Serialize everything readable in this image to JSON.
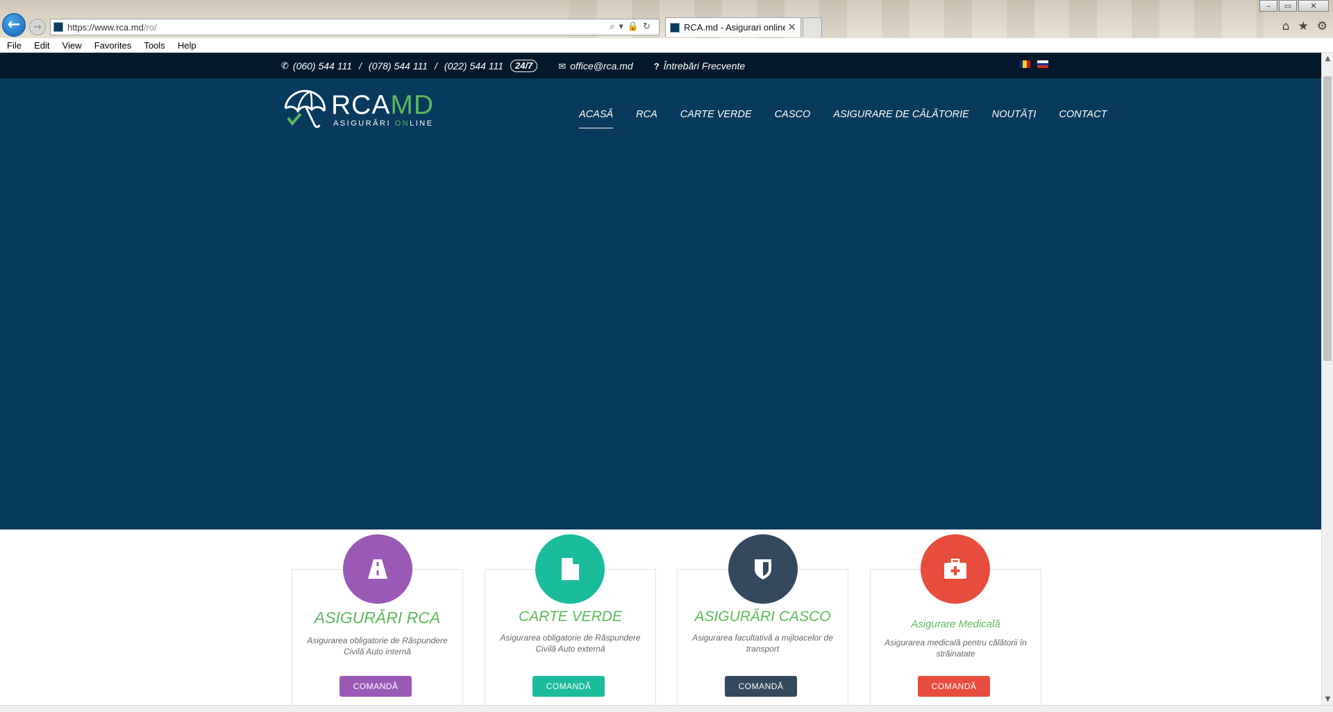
{
  "browser": {
    "url_host": "https://www.rca.md",
    "url_path": "/ro/",
    "tab_title": "RCA.md - Asigurari online -...",
    "tab_close": "✕",
    "menu": [
      "File",
      "Edit",
      "View",
      "Favorites",
      "Tools",
      "Help"
    ],
    "address_tools": "⌕▾🔒↻",
    "right_tools": [
      "⌂",
      "★",
      "⚙"
    ],
    "window_buttons": [
      "–",
      "▭",
      "✕"
    ]
  },
  "topbar": {
    "phones": [
      "(060) 544 111",
      "(078) 544 111",
      "(022) 544 111"
    ],
    "phone_separator": "/",
    "badge": "24/7",
    "email": "office@rca.md",
    "faq": "Întrebări Frecvente",
    "languages": [
      "ro",
      "ru"
    ],
    "flag_colors": {
      "ro": [
        "#002b7f",
        "#fcd116",
        "#ce1126"
      ],
      "ru": [
        "#ffffff",
        "#0039a6",
        "#d52b1e"
      ]
    }
  },
  "logo": {
    "text_primary": "RCA",
    "text_accent": "MD",
    "subtitle_pre": "ASIGURĂRI ",
    "subtitle_on": "ON",
    "subtitle_post": "LINE",
    "accent_color": "#5cb85c"
  },
  "nav": {
    "items": [
      "ACASĂ",
      "RCA",
      "CARTE VERDE",
      "CASCO",
      "ASIGURARE DE CĂLĂTORIE",
      "NOUTĂȚI",
      "CONTACT"
    ],
    "active_index": 0
  },
  "hero": {
    "background": "#083a5e"
  },
  "cards": [
    {
      "title": "ASIGURĂRI RCA",
      "desc": "Asigurarea obligatorie de Răspundere Civilă Auto internă",
      "button": "COMANDĂ",
      "color": "#9b59b6",
      "icon": "road-icon"
    },
    {
      "title": "CARTE VERDE",
      "desc": "Asigurarea obligatorie de Răspundere Civilă Auto externă",
      "button": "COMANDĂ",
      "color": "#1abc9c",
      "icon": "document-icon"
    },
    {
      "title": "ASIGURĂRI CASCO",
      "desc": "Asigurarea facultativă a mijloacelor de transport",
      "button": "COMANDĂ",
      "color": "#34495e",
      "icon": "shield-icon"
    },
    {
      "title": "Asigurare Medicală",
      "desc": "Asigurarea medicală pentru călătorii în străinatate",
      "button": "COMANDĂ",
      "color": "#e74c3c",
      "icon": "medkit-icon"
    }
  ]
}
